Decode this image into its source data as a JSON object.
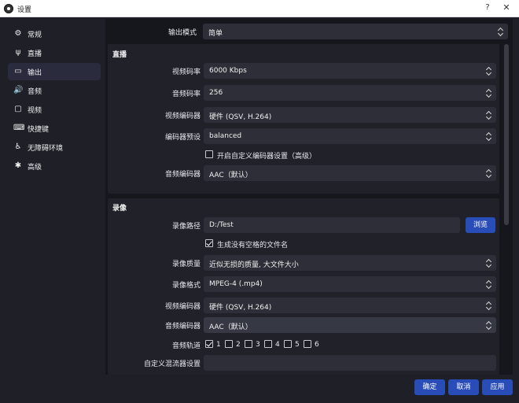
{
  "window": {
    "title": "设置",
    "help_glyph": "?",
    "close_glyph": "✕"
  },
  "sidebar": {
    "items": [
      {
        "label": "常规",
        "icon": "gear-icon",
        "glyph": "⚙",
        "active": false
      },
      {
        "label": "直播",
        "icon": "antenna-icon",
        "glyph": "ψ",
        "active": false
      },
      {
        "label": "输出",
        "icon": "output-icon",
        "glyph": "▭",
        "active": true
      },
      {
        "label": "音频",
        "icon": "speaker-icon",
        "glyph": "🔊",
        "active": false
      },
      {
        "label": "视频",
        "icon": "monitor-icon",
        "glyph": "▢",
        "active": false
      },
      {
        "label": "快捷键",
        "icon": "keyboard-icon",
        "glyph": "⌨",
        "active": false
      },
      {
        "label": "无障碍环境",
        "icon": "accessibility-icon",
        "glyph": "♿",
        "active": false
      },
      {
        "label": "高级",
        "icon": "tools-icon",
        "glyph": "✱",
        "active": false
      }
    ]
  },
  "output_mode": {
    "label": "输出模式",
    "value": "简单"
  },
  "streaming": {
    "title": "直播",
    "video_bitrate": {
      "label": "视频码率",
      "value": "6000 Kbps"
    },
    "audio_bitrate": {
      "label": "音频码率",
      "value": "256"
    },
    "video_encoder": {
      "label": "视频编码器",
      "value": "硬件 (QSV, H.264)"
    },
    "encoder_preset": {
      "label": "编码器预设",
      "value": "balanced"
    },
    "custom_encoder": {
      "label": "开启自定义编码器设置（高级）",
      "checked": false
    },
    "audio_encoder": {
      "label": "音频编码器",
      "value": "AAC（默认）"
    }
  },
  "recording": {
    "title": "录像",
    "path": {
      "label": "录像路径",
      "value": "D:/Test",
      "browse": "浏览"
    },
    "no_space": {
      "label": "生成没有空格的文件名",
      "checked": true
    },
    "quality": {
      "label": "录像质量",
      "value": "近似无损的质量, 大文件大小"
    },
    "format": {
      "label": "录像格式",
      "value": "MPEG-4 (.mp4)"
    },
    "video_encoder": {
      "label": "视频编码器",
      "value": "硬件 (QSV, H.264)"
    },
    "audio_encoder": {
      "label": "音频编码器",
      "value": "AAC（默认）"
    },
    "audio_tracks": {
      "label": "音频轨道",
      "tracks": [
        {
          "label": "1",
          "checked": true
        },
        {
          "label": "2",
          "checked": false
        },
        {
          "label": "3",
          "checked": false
        },
        {
          "label": "4",
          "checked": false
        },
        {
          "label": "5",
          "checked": false
        },
        {
          "label": "6",
          "checked": false
        }
      ]
    },
    "muxer": {
      "label": "自定义混流器设置",
      "value": ""
    }
  },
  "footer": {
    "ok": "确定",
    "cancel": "取消",
    "apply": "应用"
  },
  "colors": {
    "accent": "#284cb8",
    "background": "#1e1f27",
    "panel": "#202129",
    "field": "#2d2e37"
  }
}
